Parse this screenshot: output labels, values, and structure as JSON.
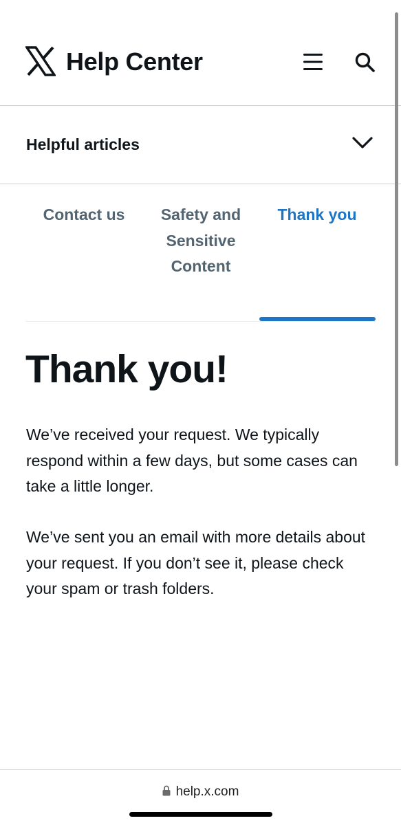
{
  "header": {
    "logo_icon": "x-logo-icon",
    "title": "Help Center",
    "menu_icon": "hamburger-menu-icon",
    "search_icon": "search-icon"
  },
  "articles": {
    "label": "Helpful articles",
    "chevron_icon": "chevron-down-icon"
  },
  "tabs": [
    {
      "label": "Contact us",
      "active": false
    },
    {
      "label": "Safety and Sensitive Content",
      "active": false
    },
    {
      "label": "Thank you",
      "active": true
    }
  ],
  "main": {
    "title": "Thank you!",
    "paragraph_1": "We’ve received your request. We typically respond within a few days, but some cases can take a little longer.",
    "paragraph_2": "We’ve sent you an email with more details about your request. If you don’t see it, please check your spam or trash folders."
  },
  "browser": {
    "url": "help.x.com",
    "lock_icon": "lock-icon"
  },
  "colors": {
    "accent": "#1d75c4",
    "text": "#0f1419",
    "muted": "#536471",
    "divider": "#c7d1d6"
  }
}
